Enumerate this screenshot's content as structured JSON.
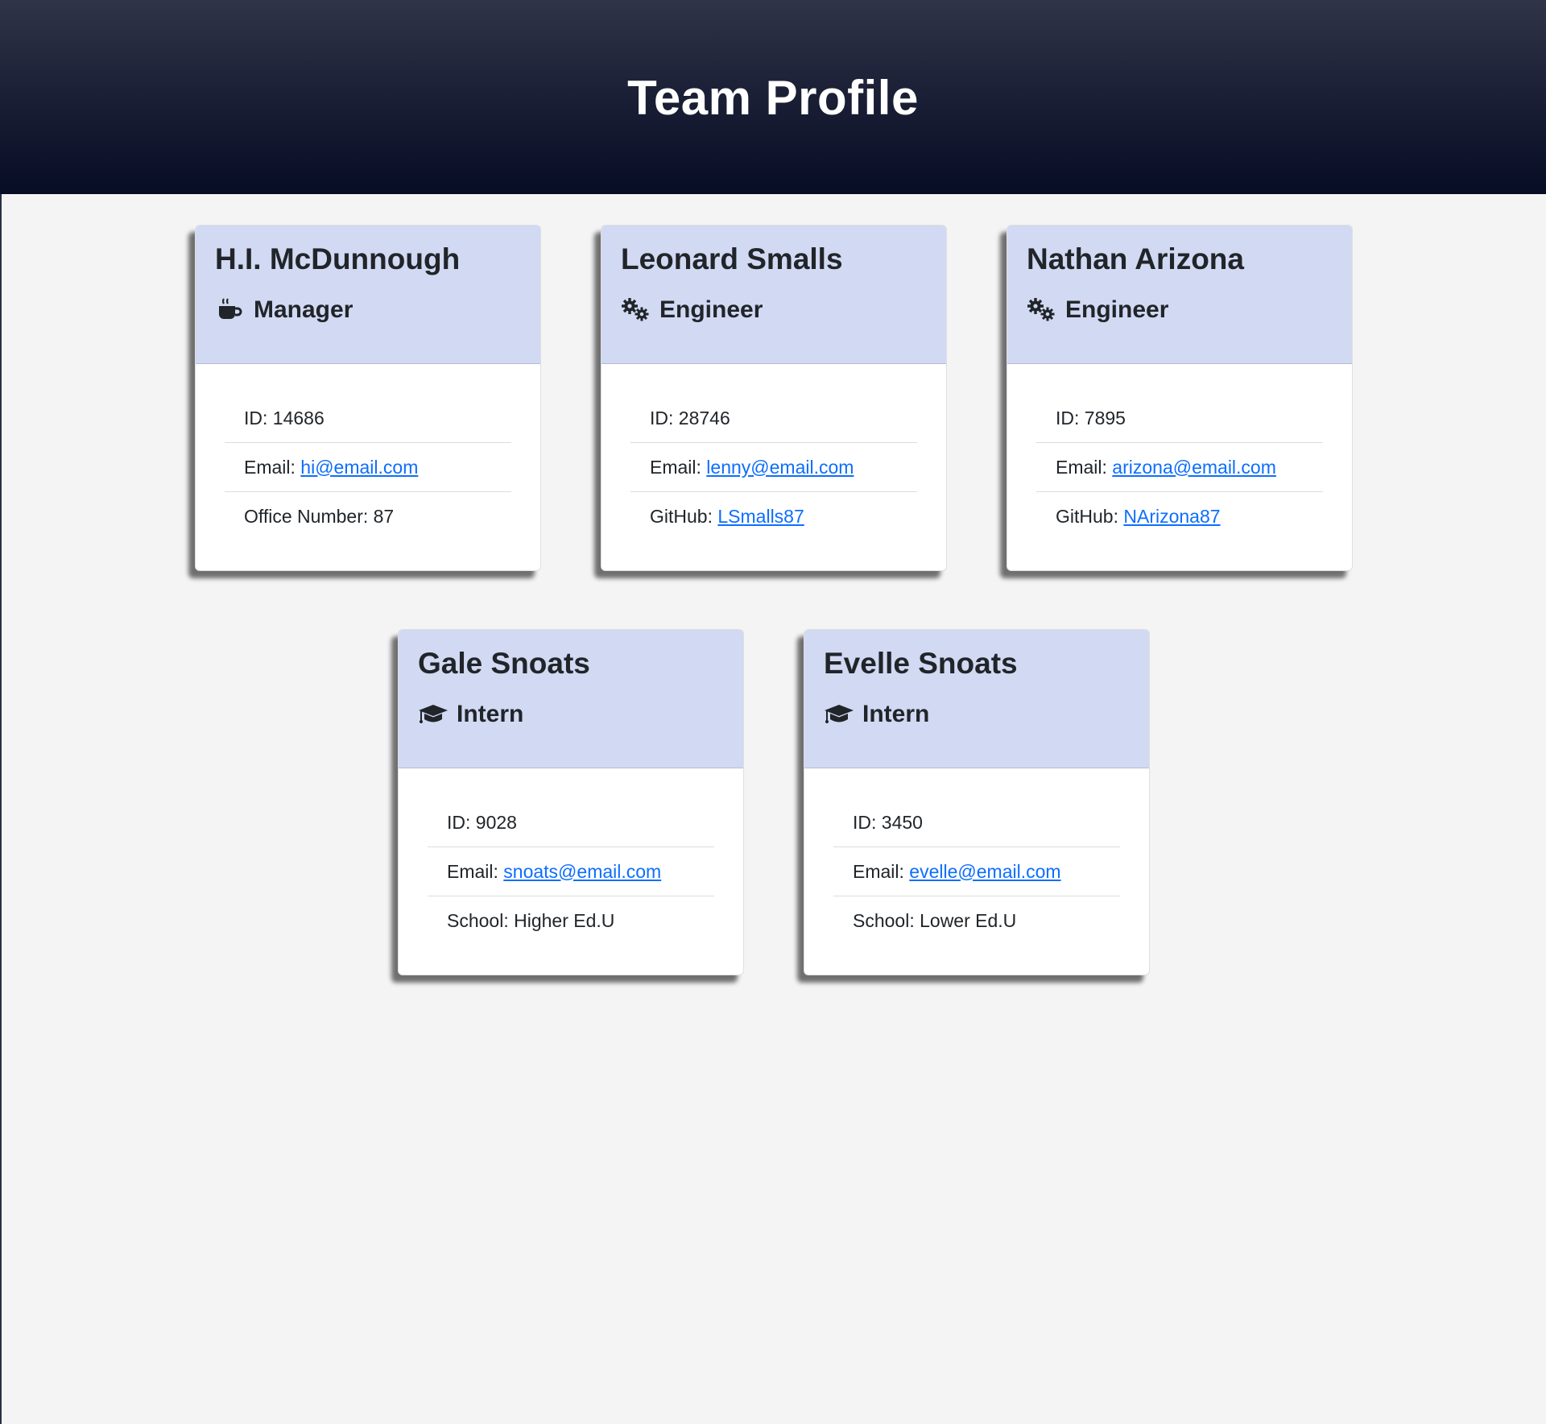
{
  "header": {
    "title": "Team Profile"
  },
  "cards": [
    {
      "name": "H.I. McDunnough",
      "role": "Manager",
      "icon": "coffee-mug-icon",
      "id_label": "ID: ",
      "id": "14686",
      "email_label": "Email: ",
      "email": "hi@email.com",
      "extra_label": "Office Number: ",
      "extra": "87"
    },
    {
      "name": "Leonard Smalls",
      "role": "Engineer",
      "icon": "gears-icon",
      "id_label": "ID: ",
      "id": "28746",
      "email_label": "Email: ",
      "email": "lenny@email.com",
      "extra_label": "GitHub: ",
      "extra": "LSmalls87"
    },
    {
      "name": "Nathan Arizona",
      "role": "Engineer",
      "icon": "gears-icon",
      "id_label": "ID: ",
      "id": "7895",
      "email_label": "Email: ",
      "email": "arizona@email.com",
      "extra_label": "GitHub: ",
      "extra": "NArizona87"
    },
    {
      "name": "Gale Snoats",
      "role": "Intern",
      "icon": "graduation-cap-icon",
      "id_label": "ID: ",
      "id": "9028",
      "email_label": "Email: ",
      "email": "snoats@email.com",
      "extra_label": "School: ",
      "extra": "Higher Ed.U"
    },
    {
      "name": "Evelle Snoats",
      "role": "Intern",
      "icon": "graduation-cap-icon",
      "id_label": "ID: ",
      "id": "3450",
      "email_label": "Email: ",
      "email": "evelle@email.com",
      "extra_label": "School: ",
      "extra": "Lower Ed.U"
    }
  ],
  "colors": {
    "header_top": "#2f3447",
    "header_bottom": "#070d24",
    "card_header": "#d1d9f3",
    "link": "#0d6efd",
    "page_bg": "#f4f4f4"
  }
}
